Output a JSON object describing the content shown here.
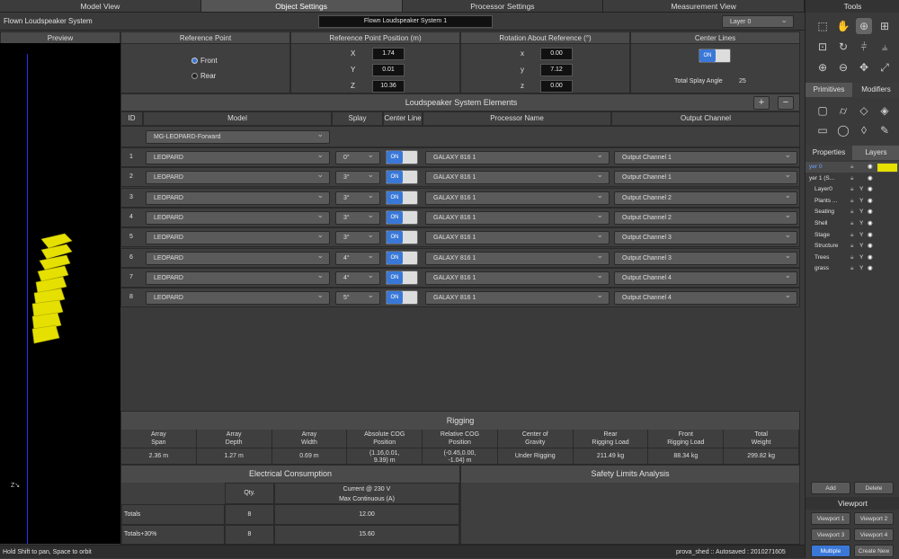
{
  "tabs": [
    "Model View",
    "Object Settings",
    "Processor Settings",
    "Measurement View"
  ],
  "title": {
    "label": "Flown Loudspeaker System",
    "name": "Flown Loudspeaker System 1",
    "layer": "Layer 0"
  },
  "sections": {
    "preview": "Preview",
    "ref_point": "Reference Point",
    "ref_pos": "Reference Point Position (m)",
    "rotation": "Rotation About Reference (°)",
    "center_lines": "Center Lines"
  },
  "ref_point": {
    "front": "Front",
    "rear": "Rear"
  },
  "position": {
    "x_label": "X",
    "y_label": "Y",
    "z_label": "Z",
    "x": "1.74",
    "y": "0.01",
    "z": "10.36"
  },
  "rotation": {
    "x_label": "x",
    "y_label": "y",
    "z_label": "z",
    "x": "0.00",
    "y": "7.12",
    "z": "0.00"
  },
  "center": {
    "toggle": "ON",
    "splay_label": "Total Splay Angle",
    "splay_value": "25"
  },
  "elements": {
    "title": "Loudspeaker System Elements",
    "add": "+",
    "remove": "−",
    "headers": [
      "ID",
      "Model",
      "Splay",
      "Center Line",
      "Processor Name",
      "Output Channel"
    ],
    "model_select": "MG-LEOPARD-Forward",
    "rows": [
      {
        "id": "1",
        "model": "LEOPARD",
        "splay": "0°",
        "cl": "ON",
        "proc": "GALAXY 816 1",
        "out": "Output Channel 1"
      },
      {
        "id": "2",
        "model": "LEOPARD",
        "splay": "3°",
        "cl": "ON",
        "proc": "GALAXY 816 1",
        "out": "Output Channel 1"
      },
      {
        "id": "3",
        "model": "LEOPARD",
        "splay": "3°",
        "cl": "ON",
        "proc": "GALAXY 816 1",
        "out": "Output Channel 2"
      },
      {
        "id": "4",
        "model": "LEOPARD",
        "splay": "3°",
        "cl": "ON",
        "proc": "GALAXY 816 1",
        "out": "Output Channel 2"
      },
      {
        "id": "5",
        "model": "LEOPARD",
        "splay": "3°",
        "cl": "ON",
        "proc": "GALAXY 816 1",
        "out": "Output Channel 3"
      },
      {
        "id": "6",
        "model": "LEOPARD",
        "splay": "4°",
        "cl": "ON",
        "proc": "GALAXY 816 1",
        "out": "Output Channel 3"
      },
      {
        "id": "7",
        "model": "LEOPARD",
        "splay": "4°",
        "cl": "ON",
        "proc": "GALAXY 816 1",
        "out": "Output Channel 4"
      },
      {
        "id": "8",
        "model": "LEOPARD",
        "splay": "5°",
        "cl": "ON",
        "proc": "GALAXY 816 1",
        "out": "Output Channel 4"
      }
    ]
  },
  "rigging": {
    "title": "Rigging",
    "cols": [
      {
        "h1": "Array",
        "h2": "Span",
        "v1": "2.36 m",
        "v2": ""
      },
      {
        "h1": "Array",
        "h2": "Depth",
        "v1": "1.27 m",
        "v2": ""
      },
      {
        "h1": "Array",
        "h2": "Width",
        "v1": "0.69 m",
        "v2": ""
      },
      {
        "h1": "Absolute COG",
        "h2": "Position",
        "v1": "(1.16,0.01,",
        "v2": "9.39) m"
      },
      {
        "h1": "Relative COG",
        "h2": "Position",
        "v1": "(-0.45,0.00,",
        "v2": "-1.04) m"
      },
      {
        "h1": "Center of",
        "h2": "Gravity",
        "v1": "Under Rigging",
        "v2": ""
      },
      {
        "h1": "Rear",
        "h2": "Rigging Load",
        "v1": "211.49 kg",
        "v2": ""
      },
      {
        "h1": "Front",
        "h2": "Rigging Load",
        "v1": "88.34 kg",
        "v2": ""
      },
      {
        "h1": "Total",
        "h2": "Weight",
        "v1": "299.82 kg",
        "v2": ""
      }
    ]
  },
  "electrical": {
    "title": "Electrical Consumption",
    "qty": "Qty.",
    "cur1": "Current @ 230 V",
    "cur2": "Max Continuous (A)",
    "rows": [
      {
        "label": "Totals",
        "qty": "8",
        "val": "12.00"
      },
      {
        "label": "Totals+30%",
        "qty": "8",
        "val": "15.60"
      }
    ]
  },
  "safety": {
    "title": "Safety Limits Analysis"
  },
  "axis": {
    "label": "Z"
  },
  "status": {
    "left": "Hold Shift to pan, Space to orbit",
    "right": "prova_shed :: Autosaved : 2010271605"
  },
  "right": {
    "tools": "Tools",
    "primitives": "Primitives",
    "modifiers": "Modifiers",
    "properties": "Properties",
    "layers": "Layers",
    "layer_rows": [
      {
        "name": "yer 0",
        "y": "",
        "sel": true
      },
      {
        "name": "yer 1 (S...",
        "y": ""
      },
      {
        "name": "Layer0",
        "y": "Y"
      },
      {
        "name": "Plants ...",
        "y": "Y"
      },
      {
        "name": "Seating",
        "y": "Y"
      },
      {
        "name": "Shell",
        "y": "Y"
      },
      {
        "name": "Stage",
        "y": "Y"
      },
      {
        "name": "Structure",
        "y": "Y"
      },
      {
        "name": "Trees",
        "y": "Y"
      },
      {
        "name": "grass",
        "y": "Y"
      }
    ],
    "add": "Add",
    "delete": "Delete",
    "viewport": "Viewport",
    "vp1": "Viewport 1",
    "vp2": "Viewport 2",
    "vp3": "Viewport 3",
    "vp4": "Viewport 4",
    "multiple": "Multiple",
    "create": "Create New",
    "colors": {
      "accent": "#3a78d8",
      "array": "#e5e000"
    }
  }
}
